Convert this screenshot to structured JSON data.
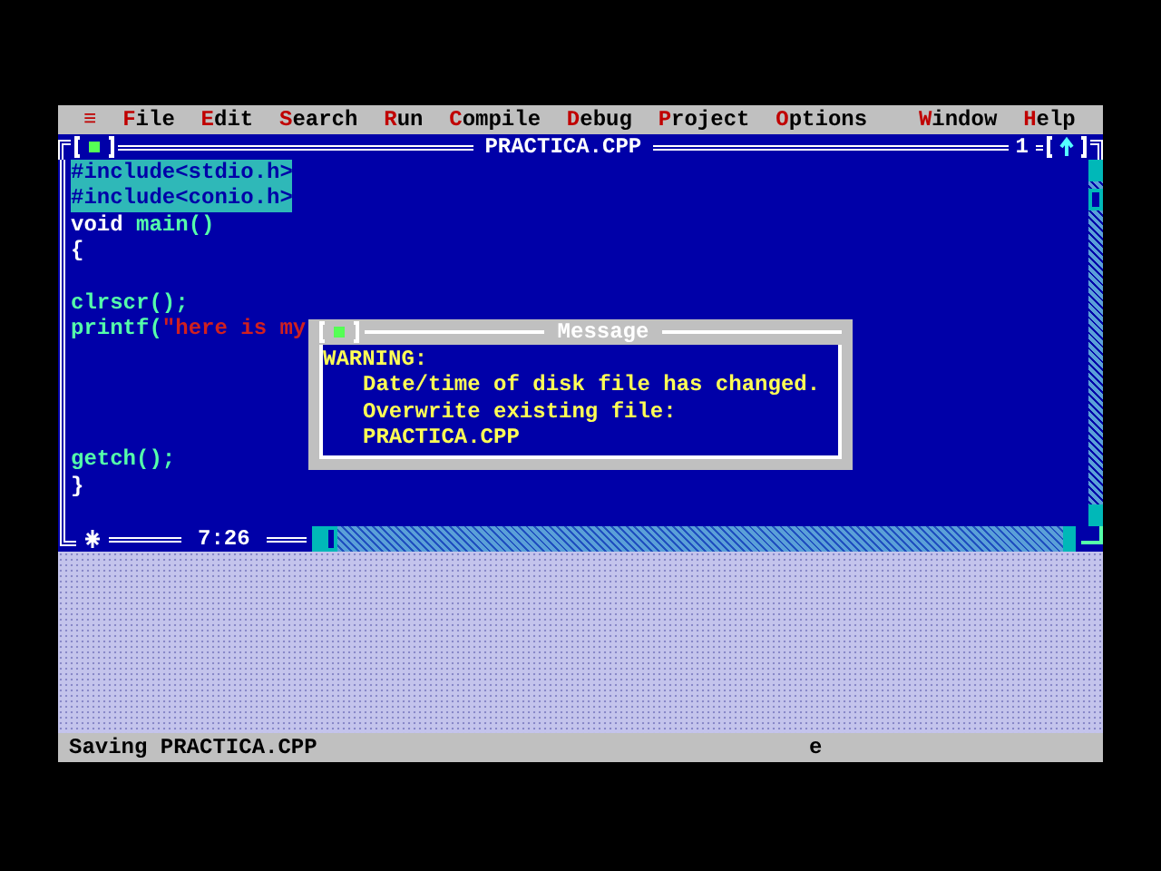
{
  "menu": [
    {
      "label": "≡"
    },
    {
      "label": "File"
    },
    {
      "label": "Edit"
    },
    {
      "label": "Search"
    },
    {
      "label": "Run"
    },
    {
      "label": "Compile"
    },
    {
      "label": "Debug"
    },
    {
      "label": "Project"
    },
    {
      "label": "Options"
    },
    {
      "label": "Window",
      "gap": true
    },
    {
      "label": "Help"
    }
  ],
  "editor": {
    "title": "PRACTICA.CPP",
    "window_number": "1",
    "cursor_position": "7:26",
    "lines": [
      {
        "kind": "code",
        "selected": true,
        "segments": [
          {
            "kind": "plain",
            "text": "#include<stdio.h>"
          }
        ]
      },
      {
        "kind": "code",
        "selected": true,
        "segments": [
          {
            "kind": "plain",
            "text": "#include<conio.h>"
          }
        ]
      },
      {
        "kind": "code",
        "selected": false,
        "segments": [
          {
            "kind": "keyword",
            "text": "void "
          },
          {
            "kind": "ident",
            "text": "main()"
          }
        ]
      },
      {
        "kind": "code",
        "selected": false,
        "segments": [
          {
            "kind": "plain",
            "text": "{"
          }
        ]
      },
      {
        "kind": "blank"
      },
      {
        "kind": "code",
        "selected": false,
        "segments": [
          {
            "kind": "ident",
            "text": "clrscr();"
          }
        ]
      },
      {
        "kind": "code",
        "selected": false,
        "segments": [
          {
            "kind": "ident",
            "text": "printf("
          },
          {
            "kind": "string",
            "text": "\"here is my"
          }
        ]
      },
      {
        "kind": "blank"
      },
      {
        "kind": "blank"
      },
      {
        "kind": "blank"
      },
      {
        "kind": "blank"
      },
      {
        "kind": "code",
        "selected": false,
        "segments": [
          {
            "kind": "ident",
            "text": "getch();"
          }
        ]
      },
      {
        "kind": "code",
        "selected": false,
        "segments": [
          {
            "kind": "plain",
            "text": "}"
          }
        ]
      }
    ]
  },
  "dialog": {
    "title": "Message",
    "heading": "WARNING:",
    "lines": [
      "Date/time of disk file has changed.",
      "Overwrite existing file:",
      "PRACTICA.CPP"
    ]
  },
  "status_bar": {
    "message": "Saving PRACTICA.CPP",
    "indicator": "e"
  }
}
